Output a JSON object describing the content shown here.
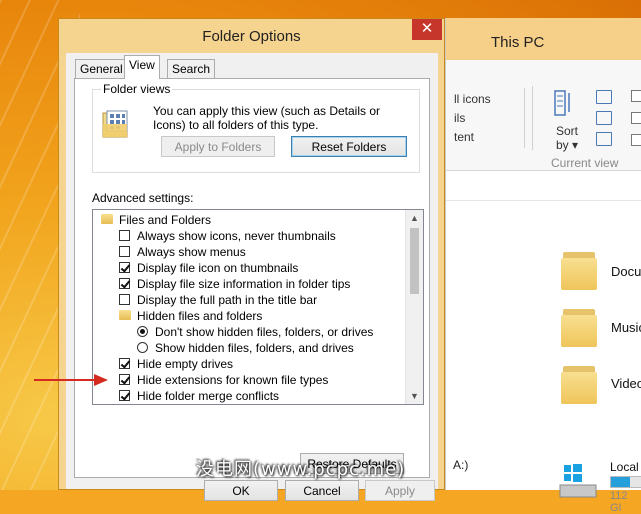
{
  "explorer": {
    "title": "This PC",
    "ribbon": {
      "layout_items": [
        "ll icons",
        "ils",
        "tent"
      ],
      "sort_label": "Sort",
      "sort_by": "by",
      "current_view": "Current view"
    },
    "folders": [
      "Docu",
      "Music",
      "Video"
    ],
    "drive": {
      "name": "Local",
      "size": "112 GI",
      "used_fraction": 0.6,
      "floppy": "A:)"
    }
  },
  "dialog": {
    "title": "Folder Options",
    "close_glyph": "✕",
    "tabs": [
      "General",
      "View",
      "Search"
    ],
    "active_tab": "View",
    "folder_views": {
      "legend": "Folder views",
      "description": "You can apply this view (such as Details or Icons) to all folders of this type.",
      "apply_button": "Apply to Folders",
      "reset_button": "Reset Folders"
    },
    "advanced_label": "Advanced settings:",
    "advanced": [
      {
        "kind": "folder",
        "label": "Files and Folders",
        "level": 0
      },
      {
        "kind": "check",
        "label": "Always show icons, never thumbnails",
        "checked": false,
        "level": 1
      },
      {
        "kind": "check",
        "label": "Always show menus",
        "checked": false,
        "level": 1
      },
      {
        "kind": "check",
        "label": "Display file icon on thumbnails",
        "checked": true,
        "level": 1
      },
      {
        "kind": "check",
        "label": "Display file size information in folder tips",
        "checked": true,
        "level": 1
      },
      {
        "kind": "check",
        "label": "Display the full path in the title bar",
        "checked": false,
        "level": 1
      },
      {
        "kind": "folder",
        "label": "Hidden files and folders",
        "level": 1
      },
      {
        "kind": "radio",
        "label": "Don't show hidden files, folders, or drives",
        "checked": true,
        "level": 2
      },
      {
        "kind": "radio",
        "label": "Show hidden files, folders, and drives",
        "checked": false,
        "level": 2
      },
      {
        "kind": "check",
        "label": "Hide empty drives",
        "checked": true,
        "level": 1
      },
      {
        "kind": "check",
        "label": "Hide extensions for known file types",
        "checked": true,
        "level": 1
      },
      {
        "kind": "check",
        "label": "Hide folder merge conflicts",
        "checked": true,
        "level": 1
      }
    ],
    "restore_button": "Restore Defaults",
    "ok_button": "OK",
    "cancel_button": "Cancel",
    "apply_button": "Apply"
  },
  "watermark": "没电网(www.pcpc.me)",
  "colors": {
    "arrow": "#d42a1f",
    "close": "#c7362a"
  }
}
